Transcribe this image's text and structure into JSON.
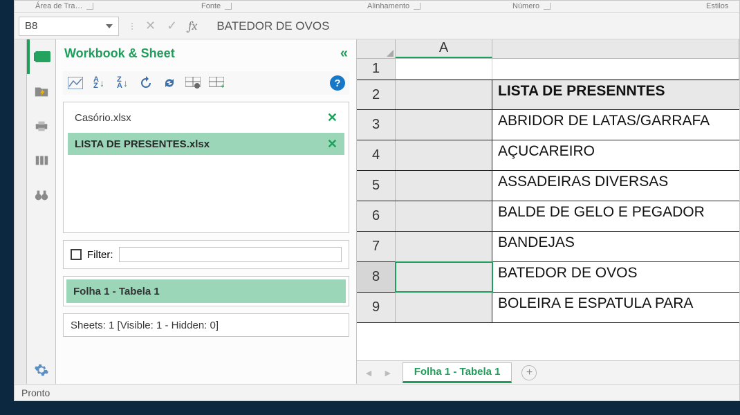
{
  "ribbon_groups": {
    "g1": "Área de Tra…",
    "g2": "Fonte",
    "g3": "Alinhamento",
    "g4": "Número",
    "g5": "Estilos"
  },
  "namebox": {
    "value": "B8"
  },
  "formula": {
    "text": "BATEDOR DE OVOS"
  },
  "panel": {
    "title": "Workbook & Sheet",
    "help": "?",
    "workbooks": [
      {
        "name": "Casório.xlsx",
        "active": false
      },
      {
        "name": "LISTA DE PRESENTES.xlsx",
        "active": true
      }
    ],
    "filter_label": "Filter:",
    "sheets": [
      {
        "name": "Folha 1 - Tabela 1",
        "active": true
      }
    ],
    "summary": "Sheets: 1  [Visible: 1 - Hidden: 0]"
  },
  "grid": {
    "col_a": "A",
    "rows": [
      {
        "n": "1",
        "a": "",
        "b": "",
        "kind": "blank"
      },
      {
        "n": "2",
        "a": "",
        "b": "LISTA DE PRESENNTES",
        "kind": "head"
      },
      {
        "n": "3",
        "a": "",
        "b": "ABRIDOR DE LATAS/GARRAFA",
        "kind": "data"
      },
      {
        "n": "4",
        "a": "",
        "b": "AÇUCAREIRO",
        "kind": "data"
      },
      {
        "n": "5",
        "a": "",
        "b": "ASSADEIRAS DIVERSAS",
        "kind": "data"
      },
      {
        "n": "6",
        "a": "",
        "b": "BALDE DE GELO E PEGADOR",
        "kind": "data"
      },
      {
        "n": "7",
        "a": "",
        "b": "BANDEJAS",
        "kind": "data"
      },
      {
        "n": "8",
        "a": "",
        "b": "BATEDOR DE OVOS",
        "kind": "data",
        "selected": true
      },
      {
        "n": "9",
        "a": "",
        "b": "BOLEIRA  E ESPATULA PARA",
        "kind": "data"
      }
    ]
  },
  "sheet_tabs": {
    "active": "Folha 1 - Tabela 1"
  },
  "status": {
    "text": "Pronto"
  }
}
